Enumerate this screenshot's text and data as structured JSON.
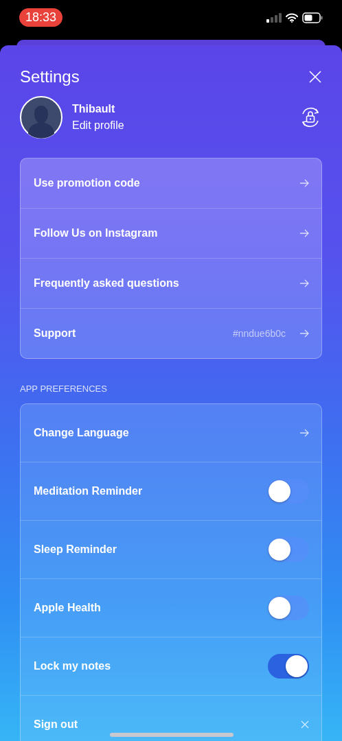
{
  "status_bar": {
    "time": "18:33"
  },
  "header": {
    "title": "Settings"
  },
  "profile": {
    "name": "Thibault",
    "action": "Edit profile"
  },
  "links": [
    {
      "kind": "link",
      "label": "Use promotion code"
    },
    {
      "kind": "link",
      "label": "Follow Us on Instagram"
    },
    {
      "kind": "link",
      "label": "Frequently asked questions"
    },
    {
      "kind": "link",
      "label": "Support",
      "value": "#nndue6b0c"
    }
  ],
  "preferences": {
    "heading": "APP PREFERENCES",
    "items": [
      {
        "kind": "link",
        "label": "Change Language"
      },
      {
        "kind": "toggle",
        "label": "Meditation Reminder",
        "on": false
      },
      {
        "kind": "toggle",
        "label": "Sleep Reminder",
        "on": false
      },
      {
        "kind": "toggle",
        "label": "Apple Health",
        "on": false
      },
      {
        "kind": "toggle",
        "label": "Lock my notes",
        "on": true
      },
      {
        "kind": "close",
        "label": "Sign out"
      }
    ]
  }
}
